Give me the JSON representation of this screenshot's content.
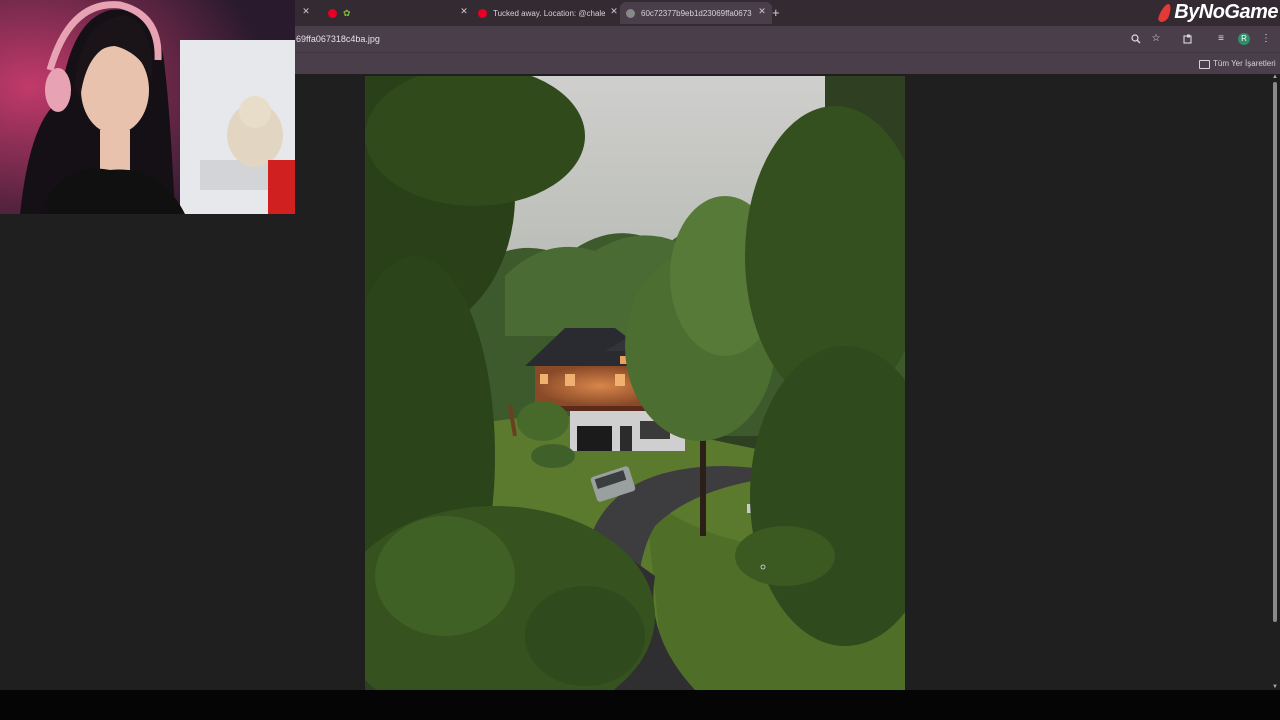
{
  "tabs": [
    {
      "label": "",
      "partial": true
    },
    {
      "label": "",
      "favicon": "pinterest-icon"
    },
    {
      "label": "Tucked away. Location: @chale",
      "favicon": "pinterest-icon"
    },
    {
      "label": "60c72377b9eb1d23069ffa0673",
      "active": true,
      "favicon": "image-icon"
    }
  ],
  "new_tab_label": "+",
  "brand": {
    "text": "ByNoGame"
  },
  "address_bar": {
    "url": "69ffa067318c4ba.jpg"
  },
  "toolbar_icons": [
    "zoom-icon",
    "bookmark-star-icon",
    "extensions-icon",
    "media-icon",
    "profile-icon",
    "menu-icon"
  ],
  "profile_initial": "R",
  "bookmarks_bar": {
    "all_bookmarks_label": "Tüm Yer İşaretleri"
  },
  "image": {
    "subject": "house-in-forest-photo"
  },
  "colors": {
    "tab_strip": "#332a32",
    "toolbar": "#4a3e4a",
    "viewer_bg": "#1f1f1f",
    "pinterest": "#e60023"
  }
}
